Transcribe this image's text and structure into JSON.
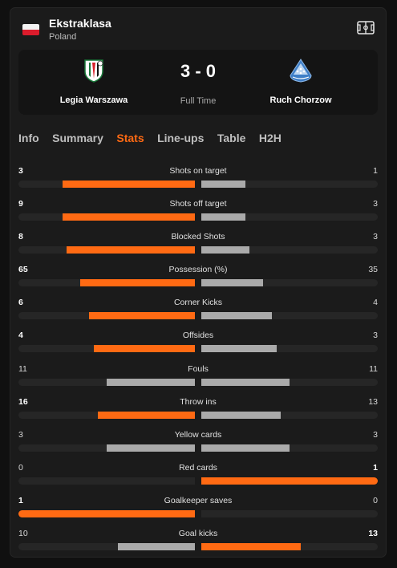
{
  "league": {
    "name": "Ekstraklasa",
    "country": "Poland",
    "flag_icon": "poland-flag-icon"
  },
  "header": {
    "pitch_icon": "pitch-icon"
  },
  "match": {
    "home": {
      "name": "Legia Warszawa",
      "logo_icon": "legia-warszawa-crest-icon"
    },
    "away": {
      "name": "Ruch Chorzow",
      "logo_icon": "ruch-chorzow-crest-icon"
    },
    "score": "3 - 0",
    "status": "Full Time"
  },
  "tabs": [
    {
      "label": "Info",
      "active": false
    },
    {
      "label": "Summary",
      "active": false
    },
    {
      "label": "Stats",
      "active": true
    },
    {
      "label": "Line-ups",
      "active": false
    },
    {
      "label": "Table",
      "active": false
    },
    {
      "label": "H2H",
      "active": false
    }
  ],
  "colors": {
    "accent": "#ff6a13",
    "neutral_bar": "#aaaaaa",
    "track": "#262626"
  },
  "stats": [
    {
      "label": "Shots on target",
      "home": 3,
      "away": 1
    },
    {
      "label": "Shots off target",
      "home": 9,
      "away": 3
    },
    {
      "label": "Blocked Shots",
      "home": 8,
      "away": 3
    },
    {
      "label": "Possession (%)",
      "home": 65,
      "away": 35
    },
    {
      "label": "Corner Kicks",
      "home": 6,
      "away": 4
    },
    {
      "label": "Offsides",
      "home": 4,
      "away": 3
    },
    {
      "label": "Fouls",
      "home": 11,
      "away": 11
    },
    {
      "label": "Throw ins",
      "home": 16,
      "away": 13
    },
    {
      "label": "Yellow cards",
      "home": 3,
      "away": 3
    },
    {
      "label": "Red cards",
      "home": 0,
      "away": 1
    },
    {
      "label": "Goalkeeper saves",
      "home": 1,
      "away": 0
    },
    {
      "label": "Goal kicks",
      "home": 10,
      "away": 13
    }
  ]
}
